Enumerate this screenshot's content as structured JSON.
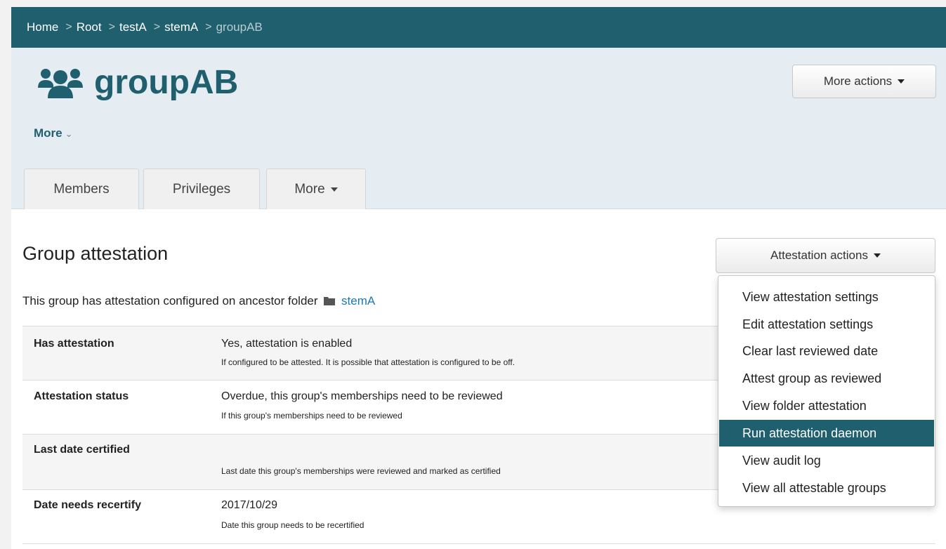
{
  "breadcrumb": [
    {
      "label": "Home"
    },
    {
      "label": "Root"
    },
    {
      "label": "testA"
    },
    {
      "label": "stemA"
    },
    {
      "label": "groupAB"
    }
  ],
  "breadcrumb_separator": ">",
  "header": {
    "title": "groupAB",
    "icon": "group-icon",
    "more_label": "More",
    "more_chevron": "⌄",
    "more_actions_label": "More actions"
  },
  "tabs": [
    {
      "label": "Members"
    },
    {
      "label": "Privileges"
    },
    {
      "label": "More"
    }
  ],
  "section": {
    "title": "Group attestation",
    "actions_label": "Attestation actions",
    "ancestor_text": "This group has attestation configured on ancestor folder",
    "ancestor_folder": "stemA",
    "ancestor_icon": "folder-icon"
  },
  "rows": [
    {
      "label": "Has attestation",
      "value": "Yes, attestation is enabled",
      "hint": "If configured to be attested. It is possible that attestation is configured to be off."
    },
    {
      "label": "Attestation status",
      "value": "Overdue, this group's memberships need to be reviewed",
      "hint": "If this group's memberships need to be reviewed"
    },
    {
      "label": "Last date certified",
      "value": "",
      "hint": "Last date this group's memberships were reviewed and marked as certified"
    },
    {
      "label": "Date needs recertify",
      "value": "2017/10/29",
      "hint": "Date this group needs to be recertified"
    }
  ],
  "attestation_menu": [
    {
      "label": "View attestation settings"
    },
    {
      "label": "Edit attestation settings"
    },
    {
      "label": "Clear last reviewed date"
    },
    {
      "label": "Attest group as reviewed"
    },
    {
      "label": "View folder attestation"
    },
    {
      "label": "Run attestation daemon",
      "highlighted": true
    },
    {
      "label": "View audit log"
    },
    {
      "label": "View all attestable groups"
    }
  ],
  "colors": {
    "brand": "#1f5f6e",
    "link": "#1a79b5",
    "header_band": "#e5edf2",
    "menu_highlight": "#1f5f6e"
  }
}
